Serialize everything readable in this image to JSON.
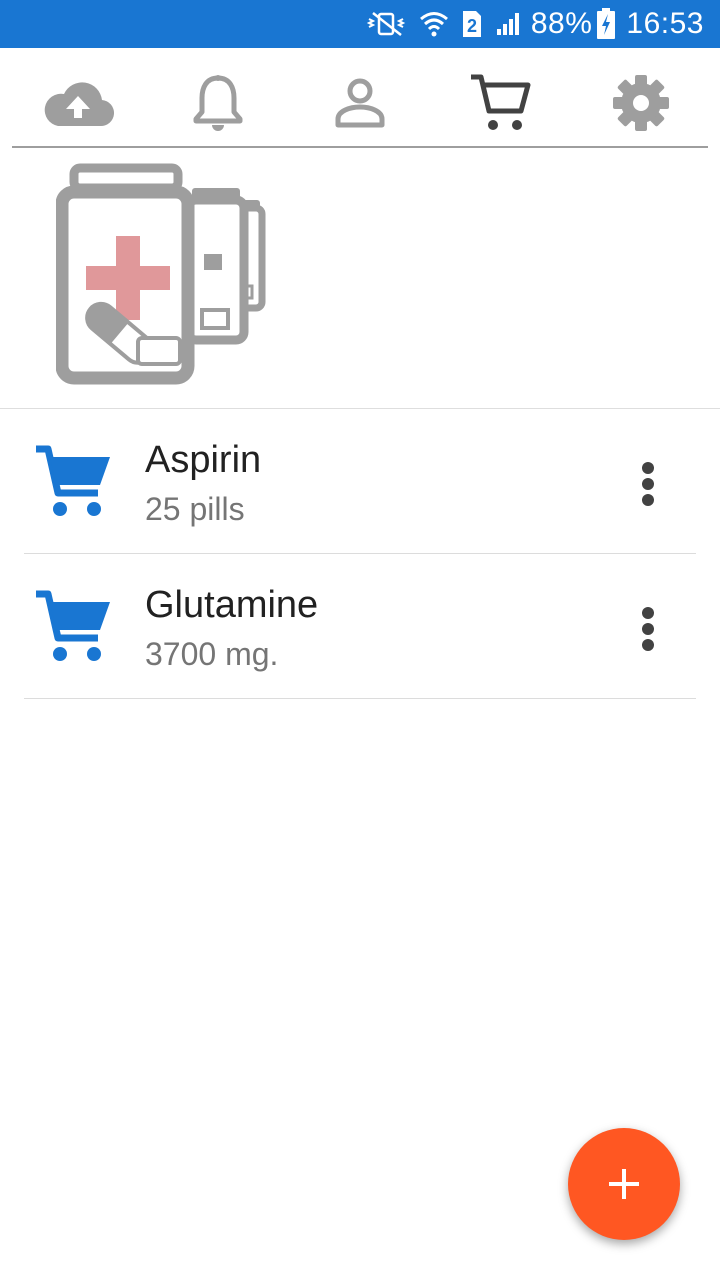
{
  "status_bar": {
    "background": "#1976d2",
    "icons": [
      "vibrate-off-icon",
      "wifi-icon",
      "sim-2-icon",
      "signal-icon",
      "battery-charging-icon"
    ],
    "sim_label": "2",
    "battery": "88%",
    "time": "16:53"
  },
  "tabs": [
    {
      "name": "cloud-upload-icon",
      "active": false
    },
    {
      "name": "bell-icon",
      "active": false
    },
    {
      "name": "person-icon",
      "active": false
    },
    {
      "name": "shopping-cart-icon",
      "active": true
    },
    {
      "name": "gear-icon",
      "active": false
    }
  ],
  "header_illustration": "pill-bottles-icon",
  "items": [
    {
      "title": "Aspirin",
      "subtitle": "25 pills",
      "icon": "cart-icon"
    },
    {
      "title": "Glutamine",
      "subtitle": "3700 mg.",
      "icon": "cart-icon"
    }
  ],
  "colors": {
    "accent_blue": "#1976d2",
    "fab": "#ff5722",
    "icon_grey": "#9e9e9e",
    "active_tab": "#424242",
    "cross_red": "#e0989a"
  },
  "fab": {
    "icon": "plus-icon"
  }
}
